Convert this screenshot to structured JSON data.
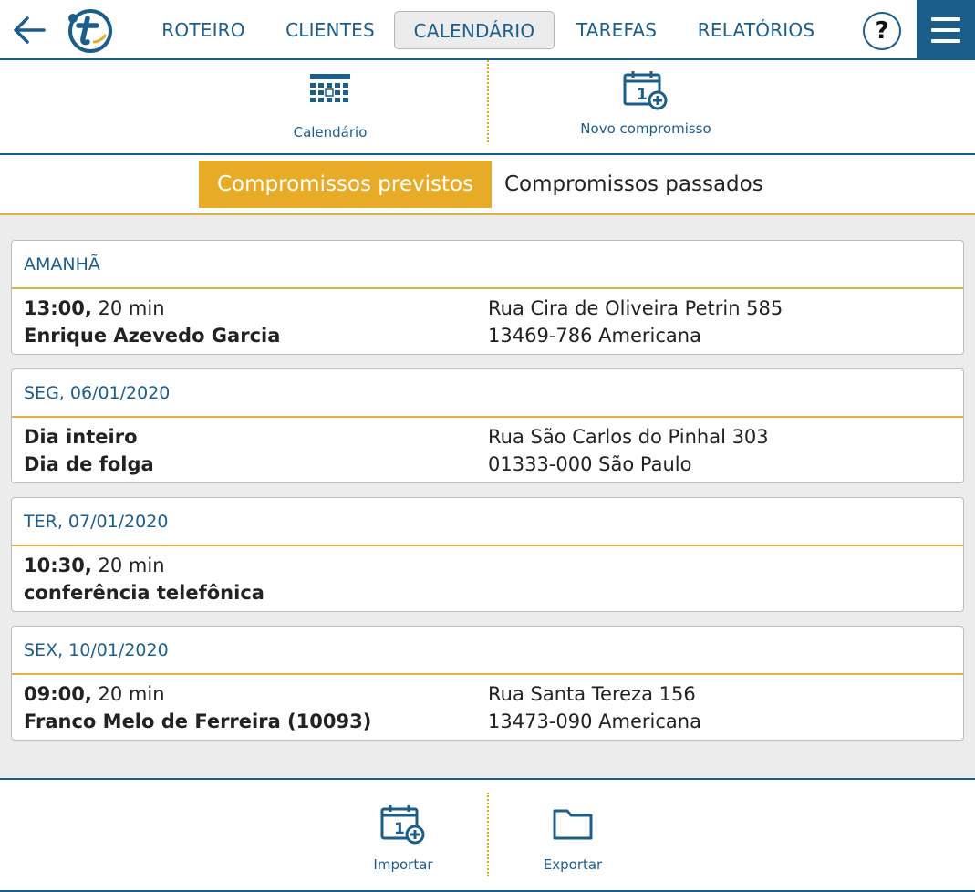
{
  "nav": {
    "items": [
      "ROTEIRO",
      "CLIENTES",
      "CALENDÁRIO",
      "TAREFAS",
      "RELATÓRIOS"
    ],
    "active": "CALENDÁRIO",
    "help_label": "?"
  },
  "toolbar": {
    "calendar_label": "Calendário",
    "new_appointment_label": "Novo compromisso"
  },
  "tabs": {
    "upcoming": "Compromissos previstos",
    "past": "Compromissos passados"
  },
  "appointments": [
    {
      "day": "AMANHÃ",
      "time": "13:00,",
      "duration": "20 min",
      "title": "Enrique Azevedo Garcia",
      "address1": "Rua Cira de Oliveira Petrin 585",
      "address2": "13469-786 Americana"
    },
    {
      "day": "SEG, 06/01/2020",
      "time": "Dia inteiro",
      "duration": "",
      "title": "Dia de folga",
      "address1": "Rua São Carlos do Pinhal 303",
      "address2": "01333-000 São Paulo"
    },
    {
      "day": "TER, 07/01/2020",
      "time": "10:30,",
      "duration": "20 min",
      "title": "conferência telefônica",
      "address1": "",
      "address2": ""
    },
    {
      "day": "SEX, 10/01/2020",
      "time": "09:00,",
      "duration": "20 min",
      "title": "Franco Melo de Ferreira (10093)",
      "address1": "Rua Santa Tereza 156",
      "address2": "13473-090 Americana"
    }
  ],
  "footer": {
    "import_label": "Importar",
    "export_label": "Exportar"
  },
  "colors": {
    "brand_blue": "#1b5e8c",
    "accent_gold": "#e8ab28",
    "background": "#ececec"
  }
}
